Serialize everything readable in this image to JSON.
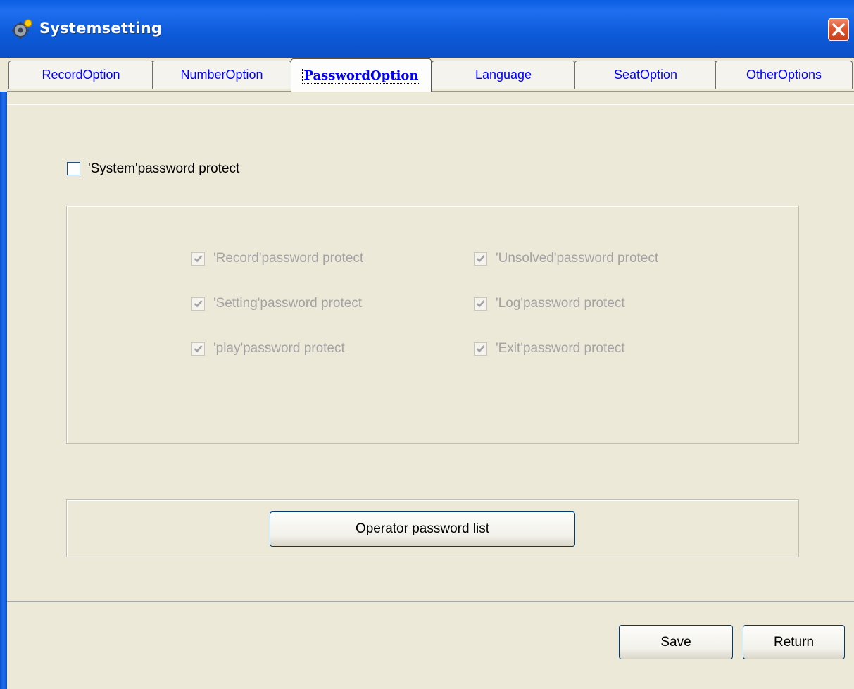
{
  "window": {
    "title": "Systemsetting"
  },
  "tabs": [
    {
      "label": "RecordOption"
    },
    {
      "label": "NumberOption"
    },
    {
      "label": "PasswordOption"
    },
    {
      "label": "Language"
    },
    {
      "label": "SeatOption"
    },
    {
      "label": "OtherOptions"
    }
  ],
  "active_tab": "PasswordOption",
  "system_protect": {
    "label": "'System'password protect",
    "checked": false
  },
  "protect_options": [
    {
      "label": "'Record'password protect",
      "checked": true,
      "enabled": false
    },
    {
      "label": "'Unsolved'password protect",
      "checked": true,
      "enabled": false
    },
    {
      "label": "'Setting'password protect",
      "checked": true,
      "enabled": false
    },
    {
      "label": "'Log'password protect",
      "checked": true,
      "enabled": false
    },
    {
      "label": "'play'password protect",
      "checked": true,
      "enabled": false
    },
    {
      "label": "'Exit'password protect",
      "checked": true,
      "enabled": false
    }
  ],
  "operator_button": "Operator password list",
  "footer": {
    "save": "Save",
    "return": "Return"
  },
  "colors": {
    "titlebar": "#0b5ad8",
    "dialog_bg": "#ece9d8",
    "tab_text": "#0000ff",
    "disabled_text": "#a3a3a3"
  },
  "icons": {
    "app": "gear-icon",
    "close": "close-icon",
    "check": "check-icon"
  }
}
